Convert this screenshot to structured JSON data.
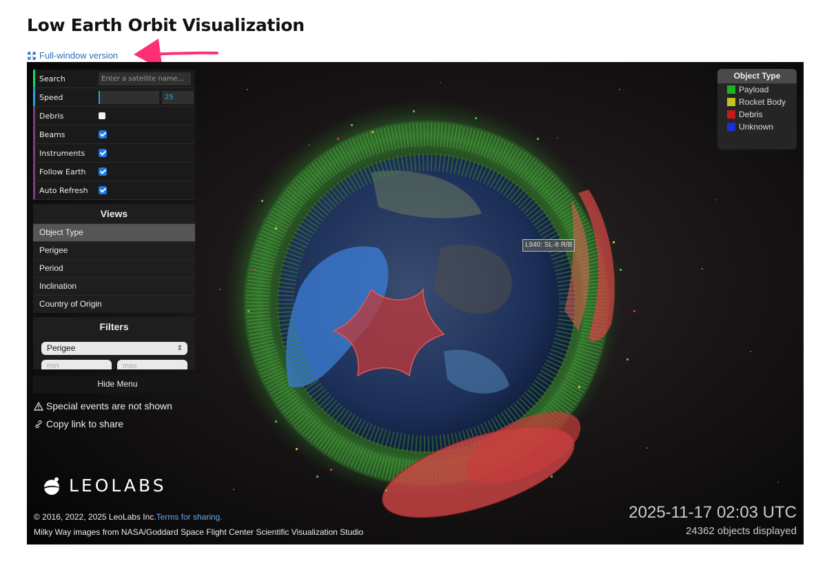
{
  "page": {
    "title": "Low Earth Orbit Visualization",
    "fullwindow_link": "Full-window version"
  },
  "controls": {
    "search_label": "Search",
    "search_placeholder": "Enter a satellite name...",
    "speed_label": "Speed",
    "speed_value": "25",
    "speed_level": 0.0,
    "debris_label": "Debris",
    "debris_checked": false,
    "beams_label": "Beams",
    "beams_checked": true,
    "instruments_label": "Instruments",
    "instruments_checked": true,
    "follow_earth_label": "Follow Earth",
    "follow_earth_checked": true,
    "auto_refresh_label": "Auto Refresh",
    "auto_refresh_checked": true
  },
  "views": {
    "title": "Views",
    "items": [
      {
        "label": "Object Type",
        "active": true
      },
      {
        "label": "Perigee",
        "active": false
      },
      {
        "label": "Period",
        "active": false
      },
      {
        "label": "Inclination",
        "active": false
      },
      {
        "label": "Country of Origin",
        "active": false
      }
    ]
  },
  "filters": {
    "title": "Filters",
    "selected": "Perigee",
    "min_placeholder": "min",
    "max_placeholder": "max"
  },
  "hide_menu": "Hide Menu",
  "notes": {
    "special_events": "Special events are not shown",
    "copy_link": "Copy link to share"
  },
  "legend": {
    "title": "Object Type",
    "items": [
      {
        "label": "Payload",
        "color": "#1eb31e"
      },
      {
        "label": "Rocket Body",
        "color": "#c8c020"
      },
      {
        "label": "Debris",
        "color": "#c41a1a"
      },
      {
        "label": "Unknown",
        "color": "#1a2fd6"
      }
    ]
  },
  "satellite_label": "L940: SL-8 R/B",
  "logo": {
    "name": "LEOLABS"
  },
  "credits": {
    "copyright": "© 2016, 2022, 2025 LeoLabs Inc.",
    "terms_link": "Terms for sharing.",
    "milky_way": "Milky Way images from NASA/Goddard Space Flight Center Scientific Visualization Studio"
  },
  "timestamp": "2025-11-17 02:03 UTC",
  "objects_displayed": "24362 objects displayed"
}
